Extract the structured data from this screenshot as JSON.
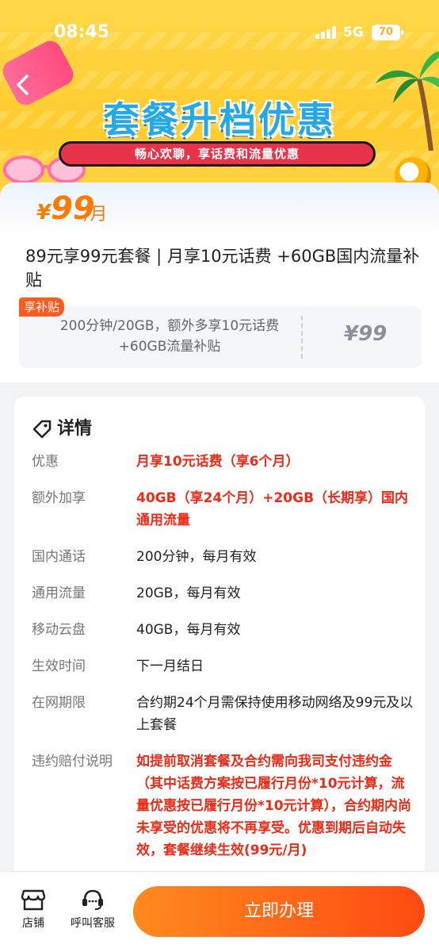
{
  "status": {
    "time": "08:45",
    "network": "5G",
    "battery": "70"
  },
  "banner": {
    "title": "套餐升档优惠",
    "subtitle": "畅心欢聊，享话费和流量优惠"
  },
  "price": {
    "currency": "¥",
    "amount": "99",
    "unit": "/月"
  },
  "plan_title": "89元享99元套餐 | 月享10元话费 +60GB国内流量补贴",
  "subsidy": {
    "tag": "享补贴",
    "text": "200分钟/20GB，额外多享10元话费 +60GB流量补贴",
    "price": "¥99"
  },
  "details": {
    "heading": "详情",
    "rows": [
      {
        "key": "优惠",
        "value": "月享10元话费（享6个月）",
        "highlight": true
      },
      {
        "key": "额外加享",
        "value": "40GB（享24个月）+20GB（长期享）国内通用流量",
        "highlight": true
      },
      {
        "key": "国内通话",
        "value": "200分钟，每月有效",
        "highlight": false
      },
      {
        "key": "通用流量",
        "value": "20GB，每月有效",
        "highlight": false
      },
      {
        "key": "移动云盘",
        "value": "40GB，每月有效",
        "highlight": false
      },
      {
        "key": "生效时间",
        "value": "下一月结日",
        "highlight": false
      },
      {
        "key": "在网期限",
        "value": "合约期24个月需保持使用移动网络及99元及以上套餐",
        "highlight": false
      },
      {
        "key": "违约赔付说明",
        "value": "如提前取消套餐及合约需向我司支付违约金（其中话费方案按已履行月份*10元计算，流量优惠按已履行月份*10元计算），合约期内尚未享受的优惠将不再享受。优惠到期后自动失效，套餐继续生效(99元/月)",
        "highlight": true
      }
    ]
  },
  "bottom_bar": {
    "store_label": "店铺",
    "service_label": "呼叫客服",
    "cta_label": "立即办理"
  },
  "colors": {
    "accent": "#ff5a1f",
    "price": "#ff7a00",
    "highlight": "#ee2b16",
    "banner": "#ffd84a"
  }
}
